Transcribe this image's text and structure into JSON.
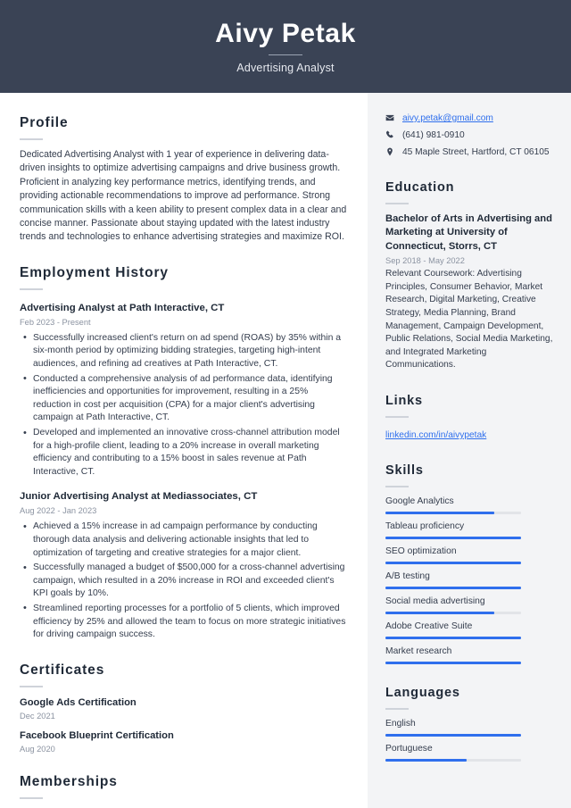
{
  "header": {
    "name": "Aivy Petak",
    "job_title": "Advertising Analyst",
    "background_color": "#3a4355"
  },
  "accent_color": "#2f6fed",
  "main": {
    "profile": {
      "heading": "Profile",
      "text": "Dedicated Advertising Analyst with 1 year of experience in delivering data-driven insights to optimize advertising campaigns and drive business growth. Proficient in analyzing key performance metrics, identifying trends, and providing actionable recommendations to improve ad performance. Strong communication skills with a keen ability to present complex data in a clear and concise manner. Passionate about staying updated with the latest industry trends and technologies to enhance advertising strategies and maximize ROI."
    },
    "employment": {
      "heading": "Employment History",
      "jobs": [
        {
          "title": "Advertising Analyst at Path Interactive, CT",
          "date": "Feb 2023 - Present",
          "bullets": [
            "Successfully increased client's return on ad spend (ROAS) by 35% within a six-month period by optimizing bidding strategies, targeting high-intent audiences, and refining ad creatives at Path Interactive, CT.",
            "Conducted a comprehensive analysis of ad performance data, identifying inefficiencies and opportunities for improvement, resulting in a 25% reduction in cost per acquisition (CPA) for a major client's advertising campaign at Path Interactive, CT.",
            "Developed and implemented an innovative cross-channel attribution model for a high-profile client, leading to a 20% increase in overall marketing efficiency and contributing to a 15% boost in sales revenue at Path Interactive, CT."
          ]
        },
        {
          "title": "Junior Advertising Analyst at Mediassociates, CT",
          "date": "Aug 2022 - Jan 2023",
          "bullets": [
            "Achieved a 15% increase in ad campaign performance by conducting thorough data analysis and delivering actionable insights that led to optimization of targeting and creative strategies for a major client.",
            "Successfully managed a budget of $500,000 for a cross-channel advertising campaign, which resulted in a 20% increase in ROI and exceeded client's KPI goals by 10%.",
            "Streamlined reporting processes for a portfolio of 5 clients, which improved efficiency by 25% and allowed the team to focus on more strategic initiatives for driving campaign success."
          ]
        }
      ]
    },
    "certificates": {
      "heading": "Certificates",
      "items": [
        {
          "name": "Google Ads Certification",
          "date": "Dec 2021"
        },
        {
          "name": "Facebook Blueprint Certification",
          "date": "Aug 2020"
        }
      ]
    },
    "memberships": {
      "heading": "Memberships"
    }
  },
  "sidebar": {
    "contact": [
      {
        "icon": "envelope-icon",
        "value": "aivy.petak@gmail.com",
        "is_link": true
      },
      {
        "icon": "phone-icon",
        "value": "(641) 981-0910",
        "is_link": false
      },
      {
        "icon": "location-pin-icon",
        "value": "45 Maple Street, Hartford, CT 06105",
        "is_link": false
      }
    ],
    "education": {
      "heading": "Education",
      "degree": "Bachelor of Arts in Advertising and Marketing at University of Connecticut, Storrs, CT",
      "date": "Sep 2018 - May 2022",
      "description": "Relevant Coursework: Advertising Principles, Consumer Behavior, Market Research, Digital Marketing, Creative Strategy, Media Planning, Brand Management, Campaign Development, Public Relations, Social Media Marketing, and Integrated Marketing Communications."
    },
    "links": {
      "heading": "Links",
      "items": [
        {
          "label": "linkedin.com/in/aivypetak"
        }
      ]
    },
    "skills": {
      "heading": "Skills",
      "items": [
        {
          "label": "Google Analytics",
          "level": 80
        },
        {
          "label": "Tableau proficiency",
          "level": 100
        },
        {
          "label": "SEO optimization",
          "level": 100
        },
        {
          "label": "A/B testing",
          "level": 100
        },
        {
          "label": "Social media advertising",
          "level": 80
        },
        {
          "label": "Adobe Creative Suite",
          "level": 100
        },
        {
          "label": "Market research",
          "level": 100
        }
      ]
    },
    "languages": {
      "heading": "Languages",
      "items": [
        {
          "label": "English",
          "level": 100
        },
        {
          "label": "Portuguese",
          "level": 60
        }
      ]
    }
  }
}
